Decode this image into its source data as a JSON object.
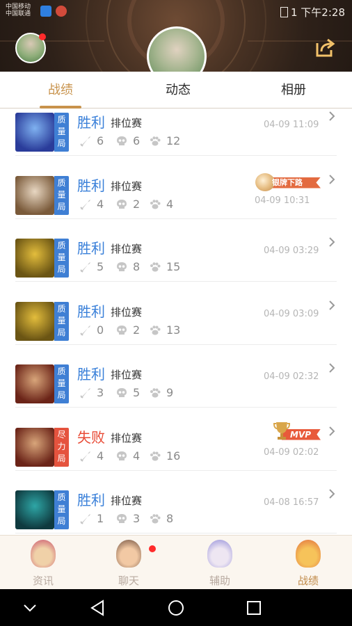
{
  "status_bar": {
    "carrier_line1": "中国移动",
    "carrier_line2": "中国联通",
    "right_text": "1 下午2:28"
  },
  "tabs": [
    {
      "label": "战绩",
      "active": true
    },
    {
      "label": "动态",
      "active": false
    },
    {
      "label": "相册",
      "active": false
    }
  ],
  "matches": [
    {
      "hero": "blue-dragon-hero",
      "hero_colors": [
        "#2a3c9a",
        "#7fb1f0"
      ],
      "mode_tag": [
        "质",
        "量",
        "局"
      ],
      "mode_color": "blue",
      "result": "胜利",
      "result_type": "win",
      "match_type": "排位赛",
      "kills": "6",
      "deaths": "6",
      "assists": "12",
      "time": "04-09 11:09",
      "badge": null
    },
    {
      "hero": "old-sage-hero",
      "hero_colors": [
        "#7a5a3a",
        "#e8d7c2"
      ],
      "mode_tag": [
        "质",
        "量",
        "局"
      ],
      "mode_color": "blue",
      "result": "胜利",
      "result_type": "win",
      "match_type": "排位赛",
      "kills": "4",
      "deaths": "2",
      "assists": "4",
      "time": "04-09 10:31",
      "badge": "silver",
      "badge_text": "银牌下路"
    },
    {
      "hero": "golden-warrior-hero",
      "hero_colors": [
        "#6b5514",
        "#e3bd3c"
      ],
      "mode_tag": [
        "质",
        "量",
        "局"
      ],
      "mode_color": "blue",
      "result": "胜利",
      "result_type": "win",
      "match_type": "排位赛",
      "kills": "5",
      "deaths": "8",
      "assists": "15",
      "time": "04-09 03:29",
      "badge": null
    },
    {
      "hero": "golden-warrior-hero",
      "hero_colors": [
        "#6b5514",
        "#e3bd3c"
      ],
      "mode_tag": [
        "质",
        "量",
        "局"
      ],
      "mode_color": "blue",
      "result": "胜利",
      "result_type": "win",
      "match_type": "排位赛",
      "kills": "0",
      "deaths": "2",
      "assists": "13",
      "time": "04-09 03:09",
      "badge": null
    },
    {
      "hero": "red-armor-hero",
      "hero_colors": [
        "#6b2418",
        "#d8a57a"
      ],
      "mode_tag": [
        "质",
        "量",
        "局"
      ],
      "mode_color": "blue",
      "result": "胜利",
      "result_type": "win",
      "match_type": "排位赛",
      "kills": "3",
      "deaths": "5",
      "assists": "9",
      "time": "04-09 02:32",
      "badge": null
    },
    {
      "hero": "red-armor-hero",
      "hero_colors": [
        "#6b2418",
        "#d8a57a"
      ],
      "mode_tag": [
        "尽",
        "力",
        "局"
      ],
      "mode_color": "red",
      "result": "失败",
      "result_type": "lose",
      "match_type": "排位赛",
      "kills": "4",
      "deaths": "4",
      "assists": "16",
      "time": "04-09 02:02",
      "badge": "mvp",
      "badge_text": "MVP"
    },
    {
      "hero": "mech-hero",
      "hero_colors": [
        "#0f3a3f",
        "#2ea6a6"
      ],
      "mode_tag": [
        "质",
        "量",
        "局"
      ],
      "mode_color": "blue",
      "result": "胜利",
      "result_type": "win",
      "match_type": "排位赛",
      "kills": "1",
      "deaths": "3",
      "assists": "8",
      "time": "04-08 16:57",
      "badge": null
    }
  ],
  "stat_icons": {
    "kills": "sword-icon",
    "deaths": "skull-icon",
    "assists": "paw-icon"
  },
  "bottom_nav": [
    {
      "label": "资讯",
      "icon": "news-mascot-icon",
      "active": false,
      "colors": [
        "#c84c6a",
        "#f0d1a8"
      ]
    },
    {
      "label": "聊天",
      "icon": "chat-mascot-icon",
      "active": false,
      "colors": [
        "#6a4a3a",
        "#f2c9a4"
      ],
      "notification": true
    },
    {
      "label": "辅助",
      "icon": "assist-mascot-icon",
      "active": false,
      "colors": [
        "#8f8ad8",
        "#eee6f2"
      ]
    },
    {
      "label": "战绩",
      "icon": "record-mascot-icon",
      "active": true,
      "colors": [
        "#e06a3c",
        "#f6c35a"
      ]
    }
  ],
  "colors": {
    "accent": "#c8934c",
    "win": "#3a80d9",
    "lose": "#e84a35"
  }
}
